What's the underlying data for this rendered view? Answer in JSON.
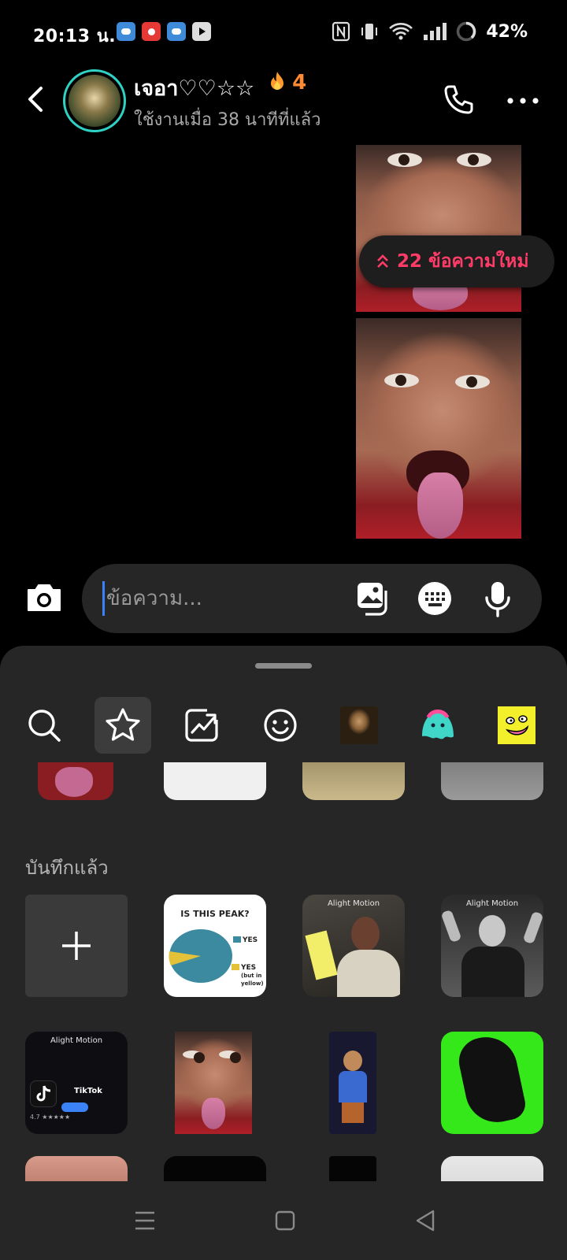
{
  "status_bar": {
    "time": "20:13 น.",
    "battery_percent": "42%",
    "notifications": [
      "weather-icon",
      "screen-record-icon",
      "weather-icon",
      "youtube-icon"
    ],
    "system_icons": [
      "nfc-icon",
      "vibrate-icon",
      "wifi-icon",
      "signal-icon",
      "battery-icon"
    ]
  },
  "header": {
    "contact_name": "เจอา♡♡☆☆",
    "streak_count": "4",
    "last_active": "ใช้งานเมื่อ 38 นาทีที่แล้ว"
  },
  "messages": {
    "new_messages_label": "22 ข้อความใหม่"
  },
  "composer": {
    "placeholder": "ข้อความ..."
  },
  "sticker_sheet": {
    "tabs": [
      "search-icon",
      "favorites-star-icon",
      "trending-icon",
      "emoji-icon",
      "pack-mona-lisa",
      "pack-ghost",
      "pack-yellow-face"
    ],
    "active_tab": 1,
    "saved_label": "บันทึกแล้ว",
    "pie_sticker": {
      "title": "IS THIS PEAK?",
      "legend_1": "YES",
      "legend_2": "YES",
      "legend_2_note": "(but in yellow)"
    },
    "alight_motion_label": "Alight Motion",
    "tiktok_label": "TikTok",
    "tiktok_rating": "4.7 ★★★★★"
  },
  "colors": {
    "accent_pink": "#ff3c68",
    "streak_orange": "#ff8a34",
    "avatar_ring": "#2fd3c4",
    "sheet_bg": "#262626"
  }
}
